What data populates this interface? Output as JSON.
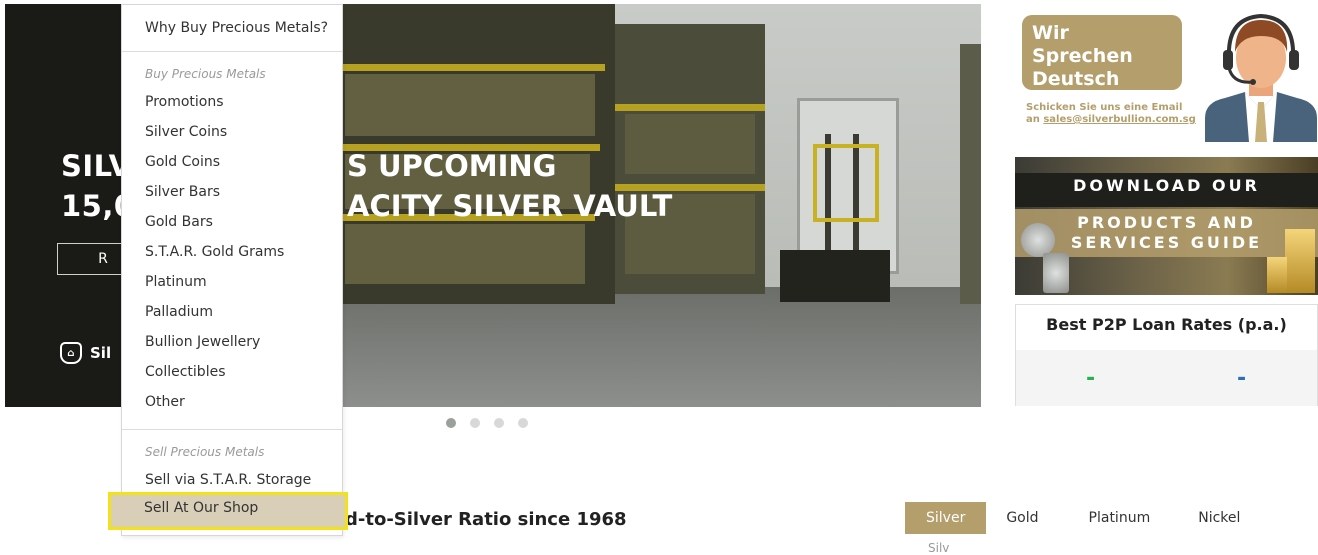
{
  "hero": {
    "title_line1_left": "SILV",
    "title_line2_left": "15,0",
    "title_line1_right": "S UPCOMING",
    "title_line2_right": "ACITY SILVER VAULT",
    "button_label": "R",
    "brand_label": "Sil",
    "brand_icon": "shield-icon"
  },
  "carousel": {
    "dots": 4,
    "active": 1
  },
  "dropdown": {
    "top_link": "Why Buy Precious Metals?",
    "buy_heading": "Buy Precious Metals",
    "buy_items": [
      "Promotions",
      "Silver Coins",
      "Gold Coins",
      "Silver Bars",
      "Gold Bars",
      "S.T.A.R. Gold Grams",
      "Platinum",
      "Palladium",
      "Bullion Jewellery",
      "Collectibles",
      "Other"
    ],
    "sell_heading": "Sell Precious Metals",
    "sell_items": [
      "Sell via S.T.A.R. Storage",
      "Sell At Our Shop"
    ],
    "highlighted_item": "Sell At Our Shop"
  },
  "promo": {
    "bubble_line1": "Wir Sprechen",
    "bubble_line2": "Deutsch",
    "small_line1": "Schicken Sie uns eine Email",
    "small_line2_prefix": "an ",
    "small_email": "sales@silverbullion.com.sg",
    "agent_icon": "support-agent-icon"
  },
  "guide": {
    "line1": "DOWNLOAD OUR",
    "line2": "PRODUCTS AND",
    "line3": "SERVICES GUIDE"
  },
  "loan": {
    "title": "Best P2P Loan Rates (p.a.)",
    "left_value": "-",
    "right_value": "-",
    "left_color": "#27b24b",
    "right_color": "#2b6fb7"
  },
  "section": {
    "ratio_title": "d-to-Silver Ratio since 1968"
  },
  "metal_tabs": [
    "Silver",
    "Gold",
    "Platinum",
    "Nickel"
  ],
  "active_metal": "Silver",
  "cut_text": "Silv",
  "colors": {
    "accent": "#b49e6c",
    "highlight_border": "#f1e21a"
  }
}
